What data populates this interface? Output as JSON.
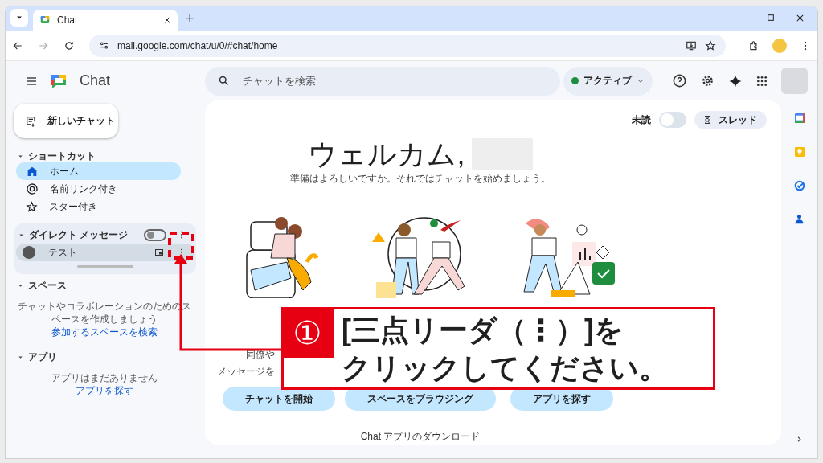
{
  "browser": {
    "tab_title": "Chat",
    "new_tab": "+",
    "url": "mail.google.com/chat/u/0/#chat/home"
  },
  "app": {
    "name": "Chat",
    "search": {
      "placeholder": "チャットを検索"
    },
    "status": {
      "label": "アクティブ",
      "color": "#1e8e3e"
    }
  },
  "sidebar": {
    "new_chat": "新しいチャット",
    "sections": [
      {
        "kind": "list",
        "title": "ショートカット",
        "items": [
          {
            "label": "ホーム",
            "selected": true
          },
          {
            "label": "名前リンク付き",
            "selected": false
          },
          {
            "label": "スター付き",
            "selected": false
          }
        ]
      },
      {
        "kind": "dm",
        "title": "ダイレクト メッセージ",
        "toggle_on": false,
        "items": [
          {
            "label": "テスト",
            "selected": false
          }
        ]
      },
      {
        "kind": "empty",
        "title": "スペース",
        "text": "チャットやコラボレーションのためのスペースを作成しましょう",
        "link": "参加するスペースを検索"
      },
      {
        "kind": "empty",
        "title": "アプリ",
        "text": "アプリはまだありません",
        "link": "アプリを探す"
      }
    ]
  },
  "main": {
    "unread": {
      "label": "未読",
      "on": false
    },
    "threads": "スレッド",
    "welcome": "ウェルカム,",
    "subtitle": "準備はよろしいですか。それではチャットを始めましょう。",
    "cards": [
      {
        "description": [
          "同僚や",
          "メッセージを"
        ],
        "button": "チャットを開始"
      },
      {
        "button": "スペースをブラウジング"
      },
      {
        "button": "アプリを探す"
      }
    ],
    "download": "Chat アプリのダウンロード"
  },
  "callout": {
    "number": "①",
    "lines": [
      "[三点リーダ（⋮）]を",
      "クリックしてください。"
    ]
  }
}
